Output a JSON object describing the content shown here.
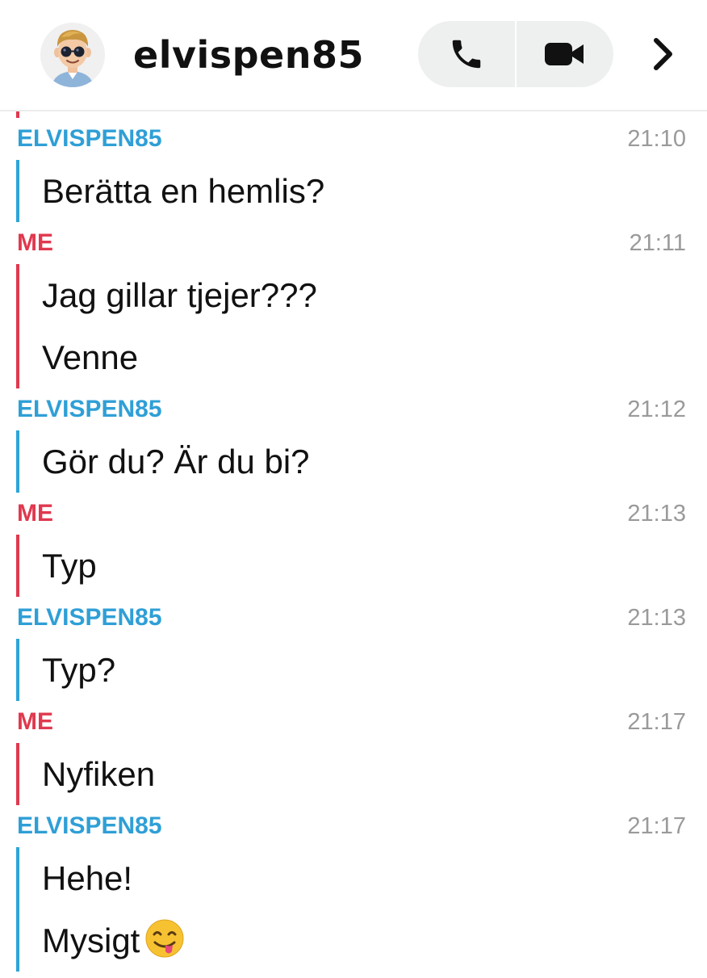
{
  "header": {
    "username": "elvispen85",
    "avatar_icon": "bitmoji-avatar-icon",
    "phone_icon": "phone-icon",
    "video_icon": "video-camera-icon",
    "chevron_icon": "chevron-right-icon"
  },
  "colors": {
    "them": "#2f9fd6",
    "me": "#e0394f",
    "time": "#9a9a9a"
  },
  "messages": [
    {
      "sender": "ELVISPEN85",
      "time": "21:10",
      "lines": [
        "Berätta en hemlis?"
      ]
    },
    {
      "sender": "ME",
      "time": "21:11",
      "lines": [
        "Jag gillar tjejer???",
        "Venne"
      ]
    },
    {
      "sender": "ELVISPEN85",
      "time": "21:12",
      "lines": [
        "Gör du? Är du bi?"
      ]
    },
    {
      "sender": "ME",
      "time": "21:13",
      "lines": [
        "Typ"
      ]
    },
    {
      "sender": "ELVISPEN85",
      "time": "21:13",
      "lines": [
        "Typ?"
      ]
    },
    {
      "sender": "ME",
      "time": "21:17",
      "lines": [
        "Nyfiken"
      ]
    },
    {
      "sender": "ELVISPEN85",
      "time": "21:17",
      "lines": [
        "Hehe!",
        "Mysigt"
      ]
    }
  ],
  "emoji": {
    "message_index": 6,
    "line_index": 1,
    "name": "face-savoring-food-emoji"
  }
}
